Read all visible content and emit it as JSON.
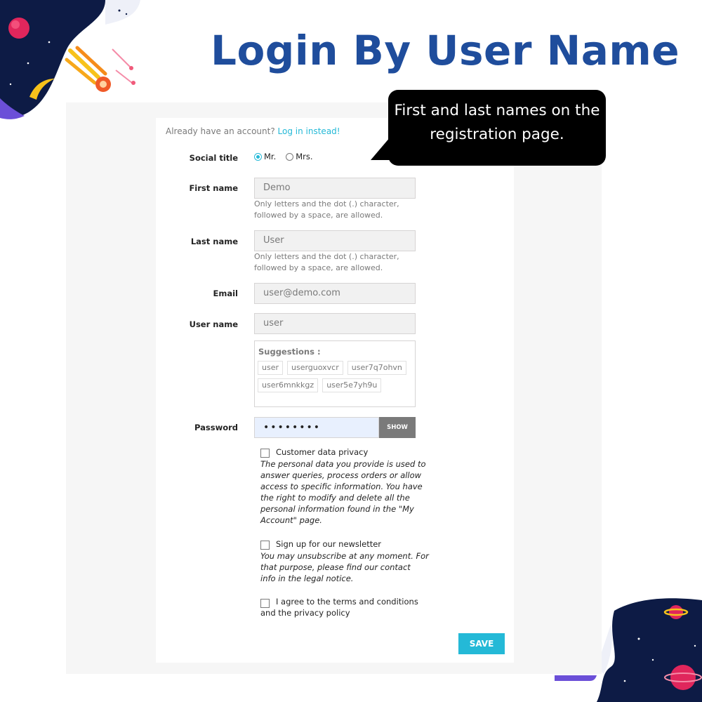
{
  "title": "Login By User Name",
  "callout": "First and last names on the registration page.",
  "form": {
    "already_text": "Already have an account?",
    "login_link": "Log in instead!",
    "social_title": {
      "label": "Social title",
      "options": [
        "Mr.",
        "Mrs."
      ],
      "selected": "Mr."
    },
    "first_name": {
      "label": "First name",
      "value": "Demo",
      "help_line1": "Only letters and the dot (.) character,",
      "help_line2": "followed by a space, are allowed."
    },
    "last_name": {
      "label": "Last name",
      "value": "User",
      "help_line1": "Only letters and the dot (.) character,",
      "help_line2": "followed by a space, are allowed."
    },
    "email": {
      "label": "Email",
      "value": "user@demo.com"
    },
    "username": {
      "label": "User name",
      "value": "user",
      "suggestions_title": "Suggestions :",
      "suggestions": [
        "user",
        "userguoxvcr",
        "user7q7ohvn",
        "user6mnkkgz",
        "user5e7yh9u"
      ]
    },
    "password": {
      "label": "Password",
      "value": "••••••••",
      "show_label": "SHOW"
    },
    "privacy": {
      "label": "Customer data privacy",
      "desc_lines": [
        "The personal data you provide is used to",
        "answer queries, process orders or allow",
        "access to specific information. You have",
        "the right to modify and delete all the",
        "personal information found in the \"My",
        "Account\" page."
      ]
    },
    "newsletter": {
      "label": "Sign up for our newsletter",
      "desc_lines": [
        "You may unsubscribe at any moment. For",
        "that purpose, please find our contact",
        "info in the legal notice."
      ]
    },
    "terms": {
      "label_line1": "I agree to the terms and conditions",
      "label_line2": "and the privacy policy"
    },
    "save_label": "SAVE"
  },
  "colors": {
    "title": "#1f4d9c",
    "accent": "#24b9d7",
    "space_dark": "#0d1b45"
  }
}
